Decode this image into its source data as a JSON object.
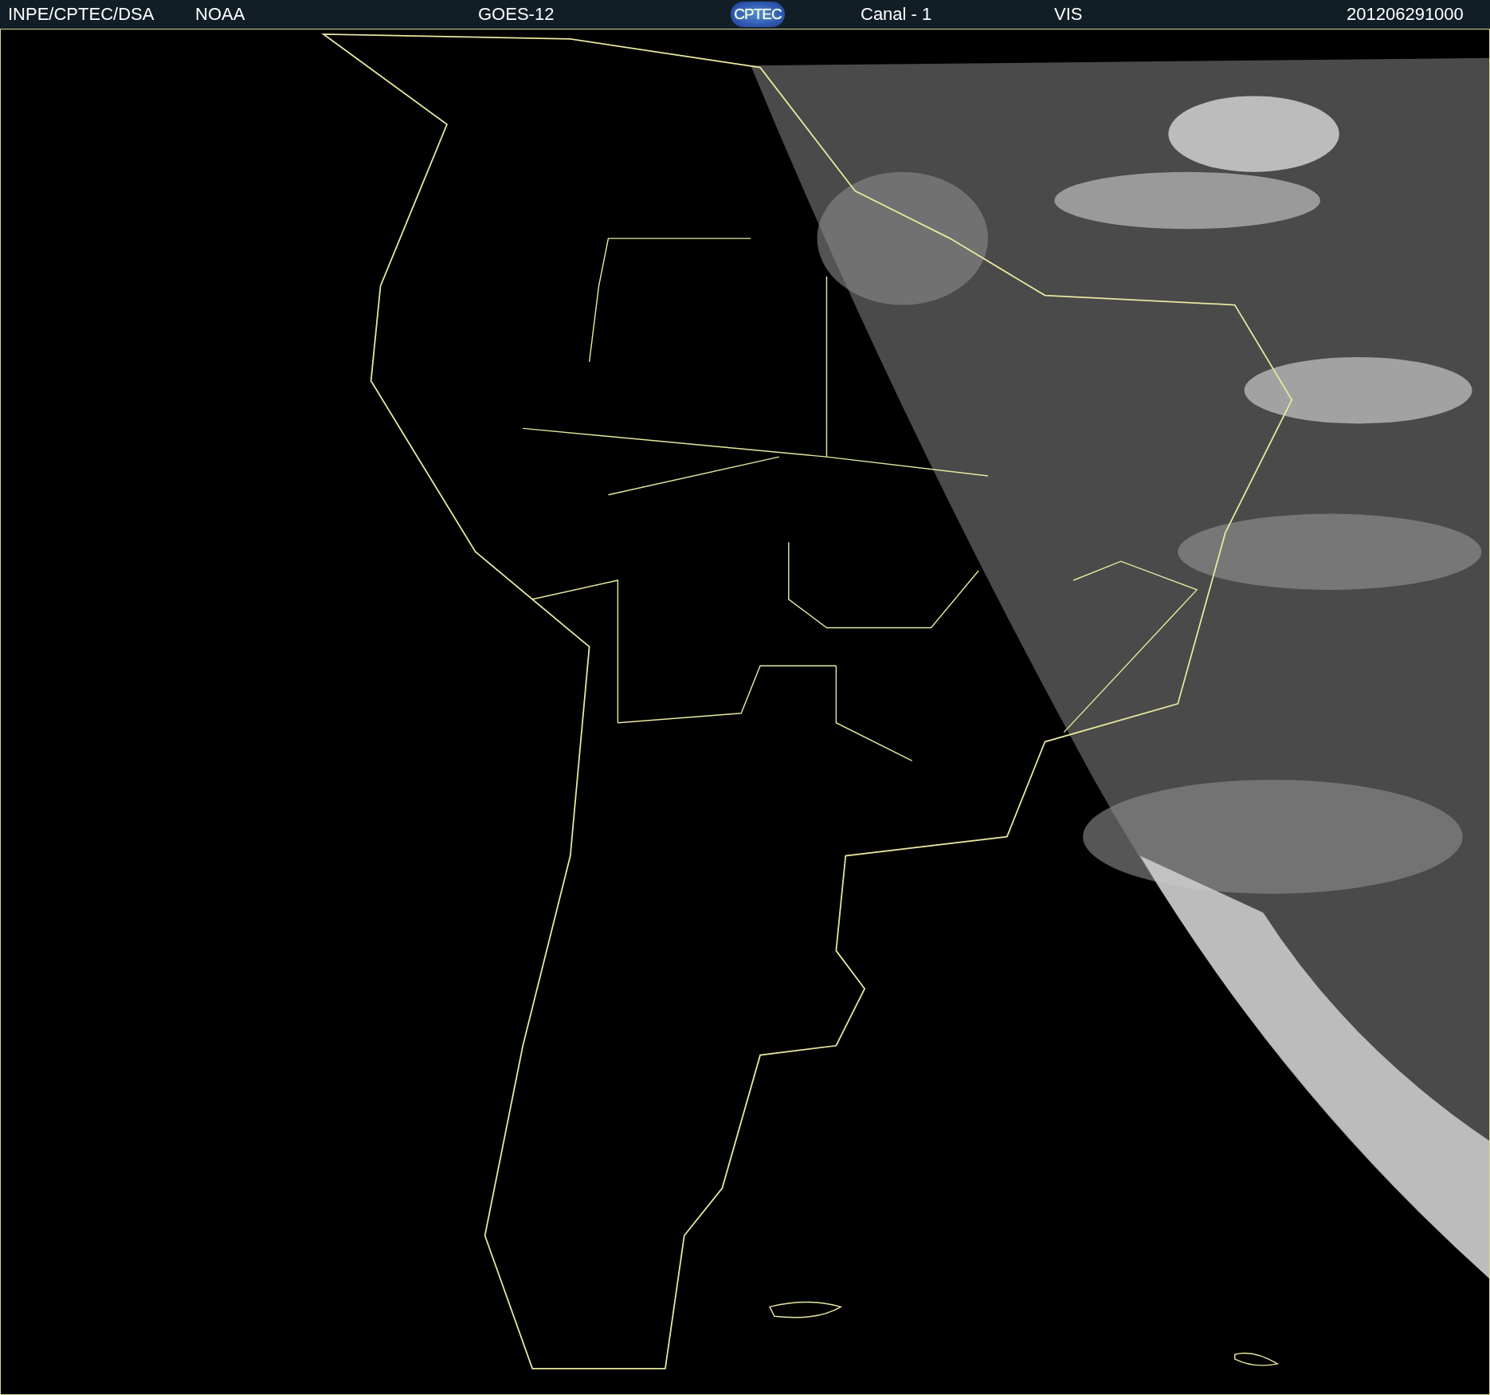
{
  "header": {
    "items": [
      {
        "kind": "text",
        "text": "INPE/CPTEC/DSA"
      },
      {
        "kind": "text",
        "text": "NOAA"
      },
      {
        "kind": "text",
        "text": "GOES-12"
      },
      {
        "kind": "logo",
        "text": "CPTEC"
      },
      {
        "kind": "text",
        "text": "Canal - 1"
      },
      {
        "kind": "text",
        "text": "VIS"
      },
      {
        "kind": "text",
        "text": "201206291000"
      }
    ]
  }
}
